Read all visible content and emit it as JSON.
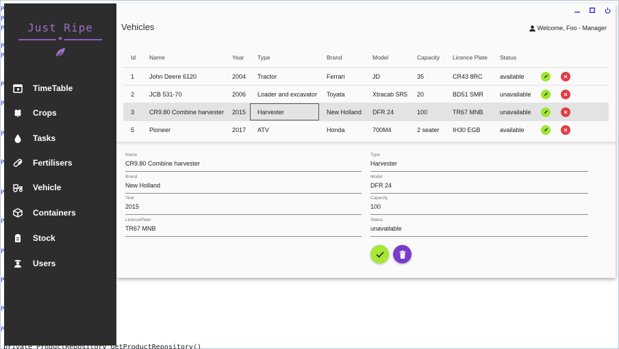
{
  "background": {
    "gutter_char": "P",
    "bottom_code": "private ProductRepository GetProductRepository()"
  },
  "sidebar": {
    "logo_text": "Just Ripe",
    "logo_star": "★",
    "items": [
      {
        "label": "TimeTable",
        "icon": "calendar-icon"
      },
      {
        "label": "Crops",
        "icon": "wheat-icon"
      },
      {
        "label": "Tasks",
        "icon": "water-drop-icon"
      },
      {
        "label": "Fertilisers",
        "icon": "pill-icon"
      },
      {
        "label": "Vehicle",
        "icon": "tractor-icon"
      },
      {
        "label": "Containers",
        "icon": "cube-icon"
      },
      {
        "label": "Stock",
        "icon": "silo-icon"
      },
      {
        "label": "Users",
        "icon": "farmer-icon"
      }
    ]
  },
  "header": {
    "title": "Vehicles",
    "welcome": "Welcome, Foo - Manager"
  },
  "table": {
    "columns": [
      "Id",
      "Name",
      "Year",
      "Type",
      "Brand",
      "Model",
      "Capacity",
      "Licence Plate",
      "Status"
    ],
    "rows": [
      [
        "1",
        "John Deere 6120",
        "2004",
        "Tractor",
        "Ferrari",
        "JD",
        "35",
        "CR43 8RC",
        "available"
      ],
      [
        "2",
        "JCB 531-70",
        "2006",
        "Loader and excavator",
        "Toyata",
        "Xtracab SR5",
        "20",
        "BD51 SMR",
        "unavailable"
      ],
      [
        "3",
        "CR9.80 Combine harvester",
        "2015",
        "Harvester",
        "New Holland",
        "DFR 24",
        "100",
        "TR67 MNB",
        "unavailable"
      ],
      [
        "5",
        "Pioneer",
        "2017",
        "ATV",
        "Honda",
        "700M4",
        "2 seater",
        "IH30 EGB",
        "available"
      ]
    ],
    "selected_row": 2
  },
  "form": {
    "name": {
      "label": "Name",
      "value": "CR9.80 Combine harvester"
    },
    "type": {
      "label": "Type",
      "value": "Harvester"
    },
    "brand": {
      "label": "Brand",
      "value": "New Holland"
    },
    "model": {
      "label": "Model",
      "value": "DFR 24"
    },
    "year": {
      "label": "Year",
      "value": "2015"
    },
    "capacity": {
      "label": "Capacity",
      "value": "100"
    },
    "licence": {
      "label": "LicencePlate",
      "value": "TR67 MNB"
    },
    "status": {
      "label": "Status",
      "value": "unavailable"
    }
  },
  "colors": {
    "sidebar_bg": "#2d2d2d",
    "brand_purple": "#9c6fc6",
    "edit_green": "#9ee62f",
    "delete_red": "#e23d43",
    "save_green": "#a8e733",
    "trash_purple": "#7a3cc9",
    "window_controls": "#3c3cc8"
  }
}
